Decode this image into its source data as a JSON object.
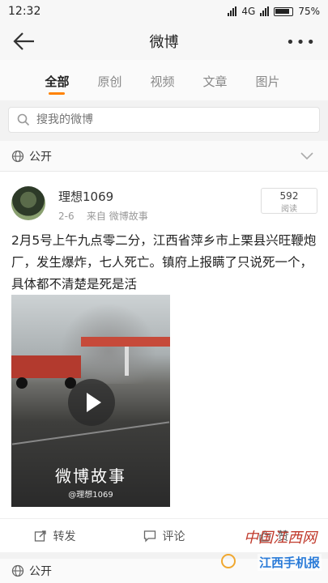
{
  "status_bar": {
    "time": "12:32",
    "network": "4G",
    "battery": "75%"
  },
  "nav": {
    "title": "微博"
  },
  "tabs": [
    {
      "label": "全部",
      "active": true
    },
    {
      "label": "原创",
      "active": false
    },
    {
      "label": "视频",
      "active": false
    },
    {
      "label": "文章",
      "active": false
    },
    {
      "label": "图片",
      "active": false
    }
  ],
  "search": {
    "placeholder": "搜我的微博"
  },
  "privacy": {
    "label": "公开"
  },
  "post": {
    "username": "理想1069",
    "date": "2-6",
    "source": "来自 微博故事",
    "read_count": "592",
    "read_label": "阅读",
    "text": "2月5号上午九点零二分，江西省萍乡市上栗县兴旺鞭炮厂，发生爆炸，七人死亡。镇府上报瞒了只说死一个，具体都不清楚是死是活",
    "video_watermark": "微博故事",
    "video_handle": "@理想1069"
  },
  "actions": {
    "repost": "转发",
    "comment": "评论",
    "like": "赞"
  },
  "privacy2": {
    "label": "公开"
  },
  "corner_watermark": {
    "top": "中国江西网",
    "bottom": "江西手机报"
  },
  "colors": {
    "accent": "#ff8200",
    "link": "#2a7bd8"
  }
}
